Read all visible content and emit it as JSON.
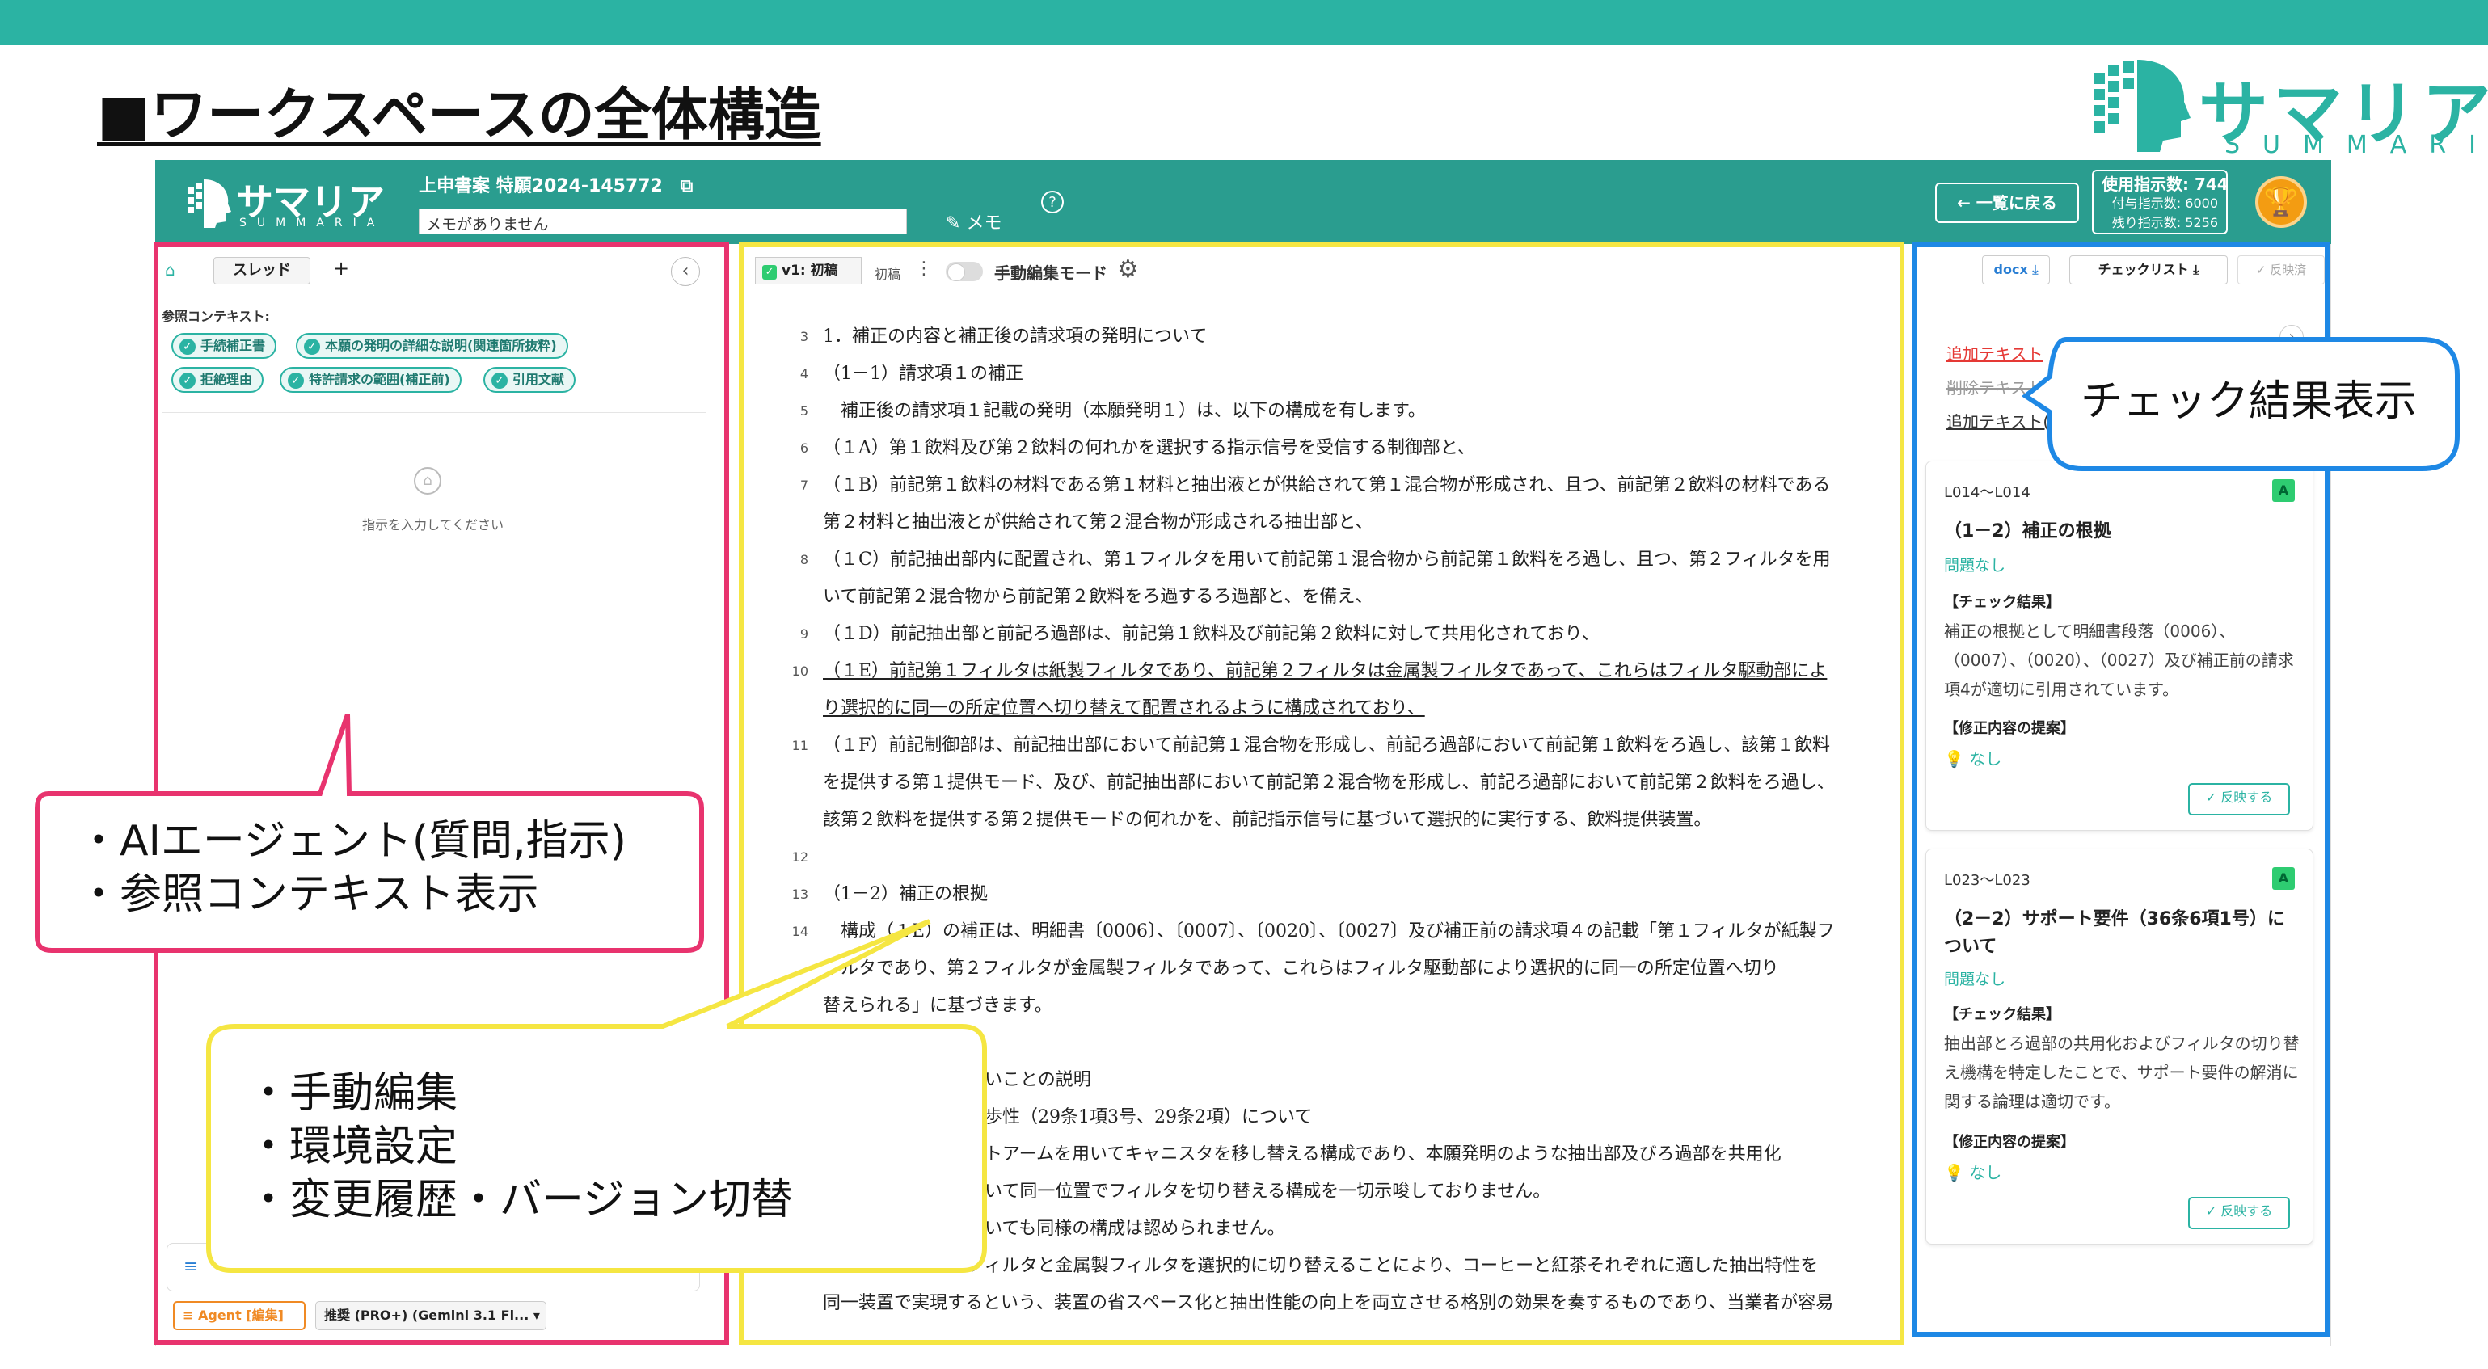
{
  "slide": {
    "title": "■ワークスペースの全体構造",
    "brand_name": "サマリア",
    "brand_sub": "SUMMARIA"
  },
  "app": {
    "logo_name": "サマリア",
    "logo_sub": "SUMMARIA",
    "doc_title": "上申書案 特願2024-145772",
    "memo_value": "メモがありません",
    "memo_button": "メモ",
    "back_button": "← 一覧に戻る",
    "usage": {
      "used_label": "使用指示数: 744",
      "granted_label": "付与指示数: 6000",
      "remaining_label": "残り指示数: 5256"
    }
  },
  "left_panel": {
    "thread_tab": "スレッド",
    "add": "+",
    "ref_label": "参照コンテキスト:",
    "chips": [
      "手続補正書",
      "本願の発明の詳細な説明(関連箇所抜粋)",
      "拒絶理由",
      "特許請求の範囲(補正前)",
      "引用文献"
    ],
    "placeholder": "指示を入力してください",
    "agent_button": "Agent [編集]",
    "model_select": "推奨 (PRO+) (Gemini 3.1 Fl... ▾"
  },
  "center_panel": {
    "version_tab": "v1: 初稿",
    "version_label": "初稿",
    "mode_label": "手動編集モード",
    "lines": [
      {
        "num": "3",
        "text": "1．補正の内容と補正後の請求項の発明について"
      },
      {
        "num": "4",
        "text": "（1－1）請求項１の補正"
      },
      {
        "num": "5",
        "text": "　補正後の請求項１記載の発明（本願発明１）は、以下の構成を有します。"
      },
      {
        "num": "6",
        "text": "（１A）第１飲料及び第２飲料の何れかを選択する指示信号を受信する制御部と、"
      },
      {
        "num": "7",
        "text": "（１B）前記第１飲料の材料である第１材料と抽出液とが供給されて第１混合物が形成され、且つ、前記第２飲料の材料である"
      },
      {
        "num": "",
        "text": "第２材料と抽出液とが供給されて第２混合物が形成される抽出部と、"
      },
      {
        "num": "8",
        "text": "（１C）前記抽出部内に配置され、第１フィルタを用いて前記第１混合物から前記第１飲料をろ過し、且つ、第２フィルタを用"
      },
      {
        "num": "",
        "text": "いて前記第２混合物から前記第２飲料をろ過するろ過部と、を備え、"
      },
      {
        "num": "9",
        "text": "（１D）前記抽出部と前記ろ過部は、前記第１飲料及び前記第２飲料に対して共用化されており、"
      },
      {
        "num": "10",
        "text": "（１E）前記第１フィルタは紙製フィルタであり、前記第２フィルタは金属製フィルタであって、これらはフィルタ駆動部によ"
      },
      {
        "num": "",
        "text": "り選択的に同一の所定位置へ切り替えて配置されるように構成されており、"
      },
      {
        "num": "11",
        "text": "（１F）前記制御部は、前記抽出部において前記第１混合物を形成し、前記ろ過部において前記第１飲料をろ過し、該第１飲料"
      },
      {
        "num": "",
        "text": "を提供する第１提供モード、及び、前記抽出部において前記第２混合物を形成し、前記ろ過部において前記第２飲料をろ過し、"
      },
      {
        "num": "",
        "text": "該第２飲料を提供する第２提供モードの何れかを、前記指示信号に基づいて選択的に実行する、飲料提供装置。"
      },
      {
        "num": "12",
        "text": ""
      },
      {
        "num": "13",
        "text": "（1－2）補正の根拠"
      },
      {
        "num": "14",
        "text": "　構成（１E）の補正は、明細書〔0006〕、〔0007〕、〔0020〕、〔0027〕及び補正前の請求項４の記載「第１フィルタが紙製フ"
      },
      {
        "num": "",
        "text": "ィルタであり、第２フィルタが金属製フィルタであって、これらはフィルタ駆動部により選択的に同一の所定位置へ切り"
      },
      {
        "num": "",
        "text": "替えられる」に基づきます。"
      },
      {
        "num": "",
        "text": ""
      },
      {
        "num": "",
        "text": "しないことの説明"
      },
      {
        "num": "",
        "text": "び進歩性（29条1項3号、29条2項）について"
      },
      {
        "num": "",
        "text": "ボットアームを用いてキャニスタを移し替える構成であり、本願発明のような抽出部及びろ過部を共用化"
      },
      {
        "num": "",
        "text": "を用いて同一位置でフィルタを切り替える構成を一切示唆しておりません。"
      },
      {
        "num": "",
        "text": "についても同様の構成は認められません。"
      },
      {
        "num": "",
        "text": "製フィルタと金属製フィルタを選択的に切り替えることにより、コーヒーと紅茶それぞれに適した抽出特性を"
      },
      {
        "num": "",
        "text": "同一装置で実現するという、装置の省スペース化と抽出性能の向上を両立させる格別の効果を奏するものであり、当業者が容易"
      }
    ]
  },
  "right_panel": {
    "docx_button": "docx",
    "checklist_button": "チェックリスト",
    "reflect_all": "反映済",
    "legend": [
      "追加テキスト",
      "削除テキスト",
      "追加テキスト("
    ],
    "cards": [
      {
        "range": "L014〜L014",
        "grade": "A",
        "title": "（1－2）補正の根拠",
        "status": "問題なし",
        "check_head": "【チェック結果】",
        "check_body": "補正の根拠として明細書段落（0006）、（0007）、（0020）、（0027）及び補正前の請求項4が適切に引用されています。",
        "suggest_head": "【修正内容の提案】",
        "suggest_body": "なし",
        "reflect_button": "反映する"
      },
      {
        "range": "L023〜L023",
        "grade": "A",
        "title": "（2－2）サポート要件（36条6項1号）について",
        "status": "問題なし",
        "check_head": "【チェック結果】",
        "check_body": "抽出部とろ過部の共用化およびフィルタの切り替え機構を特定したことで、サポート要件の解消に関する論理は適切です。",
        "suggest_head": "【修正内容の提案】",
        "suggest_body": "なし",
        "reflect_button": "反映する"
      }
    ]
  },
  "callouts": {
    "right": "チェック結果表示",
    "left": [
      "・AIエージェント(質問,指示)",
      "・参照コンテキスト表示"
    ],
    "center": [
      "・手動編集",
      "・環境設定",
      "・変更履歴・バージョン切替"
    ]
  },
  "colors": {
    "teal": "#2bb3a3",
    "frame_pink": "#e8336e",
    "frame_yellow": "#f5e642",
    "frame_blue": "#1e88e5"
  }
}
